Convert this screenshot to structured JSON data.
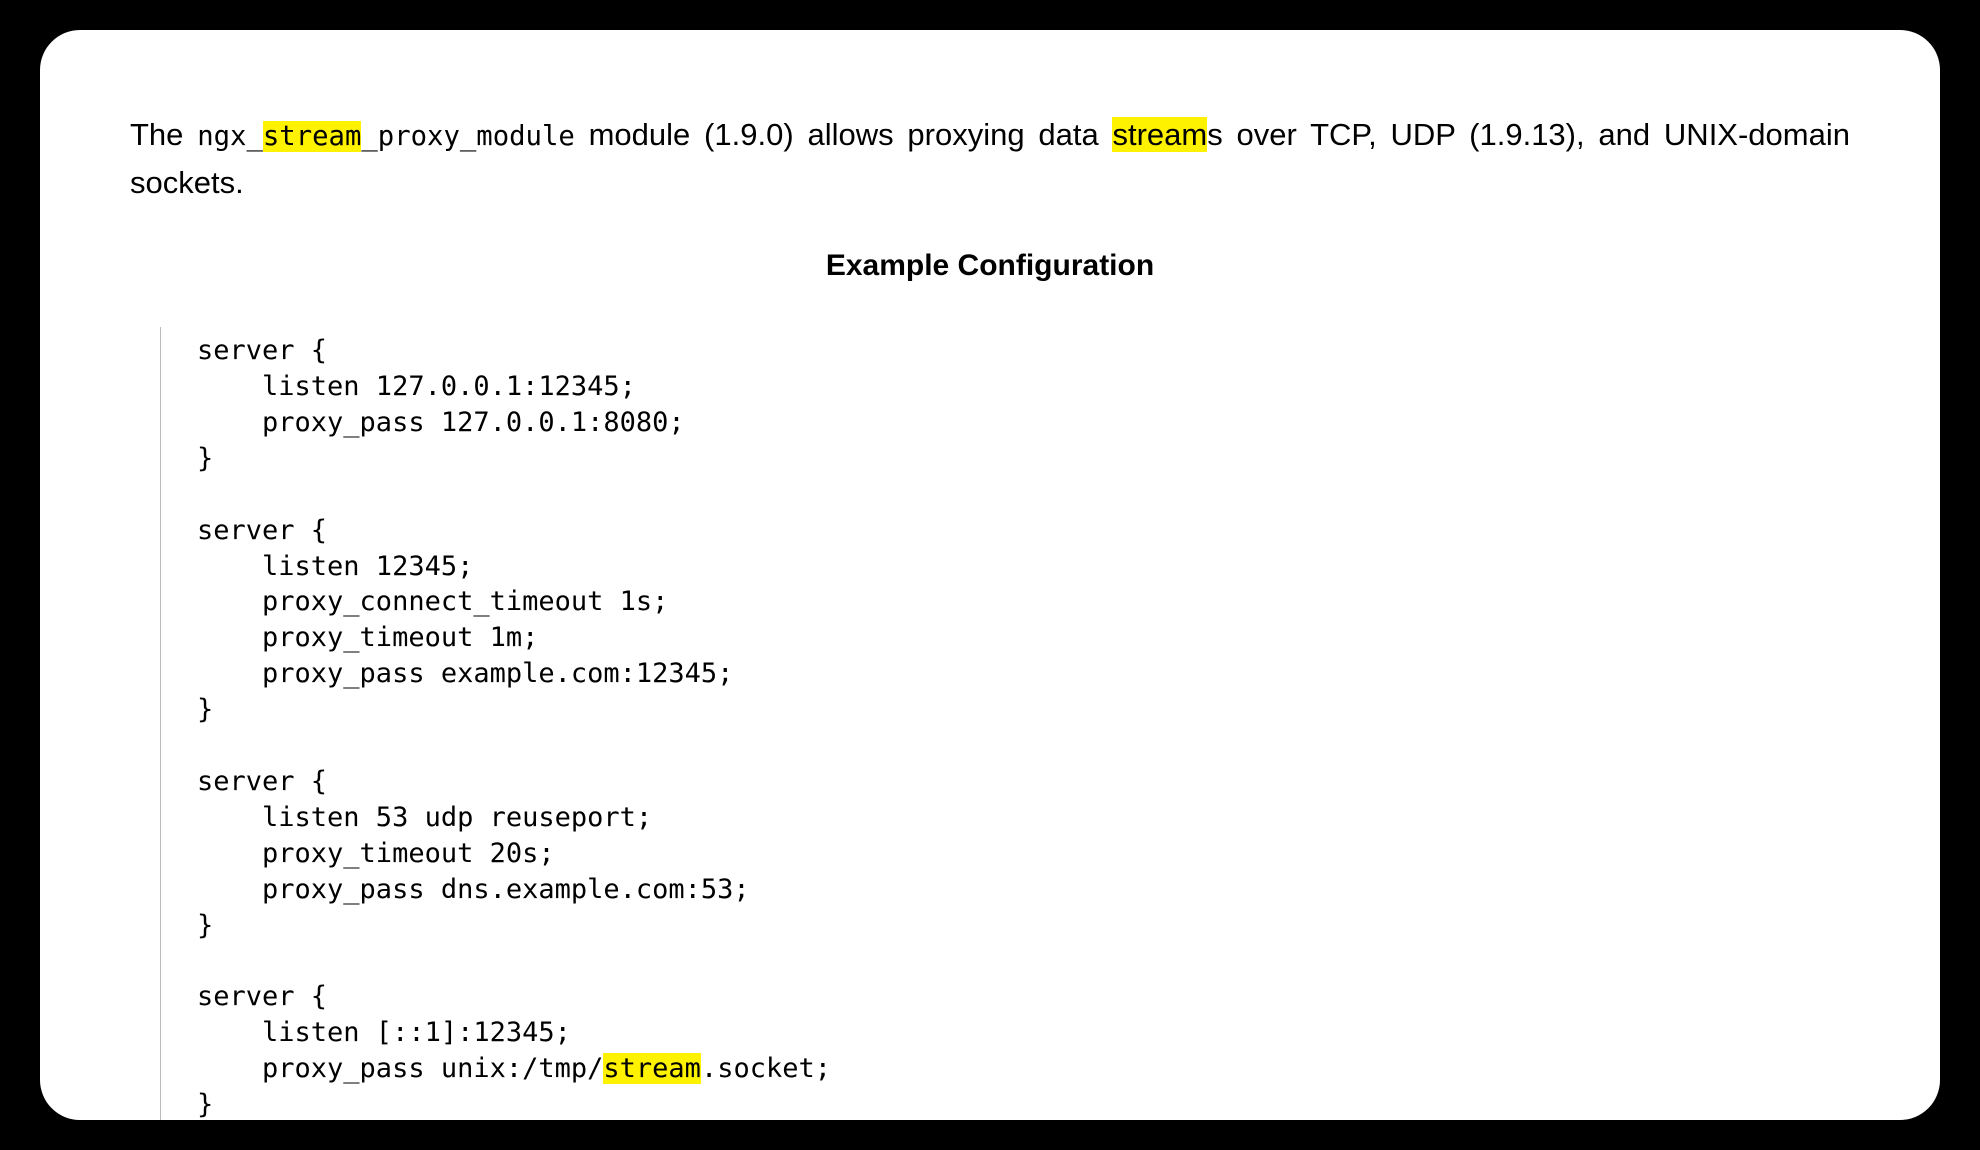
{
  "intro": {
    "t1": "The ",
    "mono_pre": "ngx_",
    "mono_hl": "stream",
    "mono_post": "_proxy_module",
    "t2": " module (1.9.0) allows proxying data ",
    "hl_word": "stream",
    "t3": "s over TCP, UDP (1.9.13), and UNIX-domain sockets."
  },
  "section_title": "Example Configuration",
  "code": {
    "l01": "server {",
    "l02": "    listen 127.0.0.1:12345;",
    "l03": "    proxy_pass 127.0.0.1:8080;",
    "l04": "}",
    "l05": "",
    "l06": "server {",
    "l07": "    listen 12345;",
    "l08": "    proxy_connect_timeout 1s;",
    "l09": "    proxy_timeout 1m;",
    "l10": "    proxy_pass example.com:12345;",
    "l11": "}",
    "l12": "",
    "l13": "server {",
    "l14": "    listen 53 udp reuseport;",
    "l15": "    proxy_timeout 20s;",
    "l16": "    proxy_pass dns.example.com:53;",
    "l17": "}",
    "l18": "",
    "l19": "server {",
    "l20": "    listen [::1]:12345;",
    "l21a": "    proxy_pass unix:/tmp/",
    "l21hl": "stream",
    "l21b": ".socket;",
    "l22": "}"
  }
}
